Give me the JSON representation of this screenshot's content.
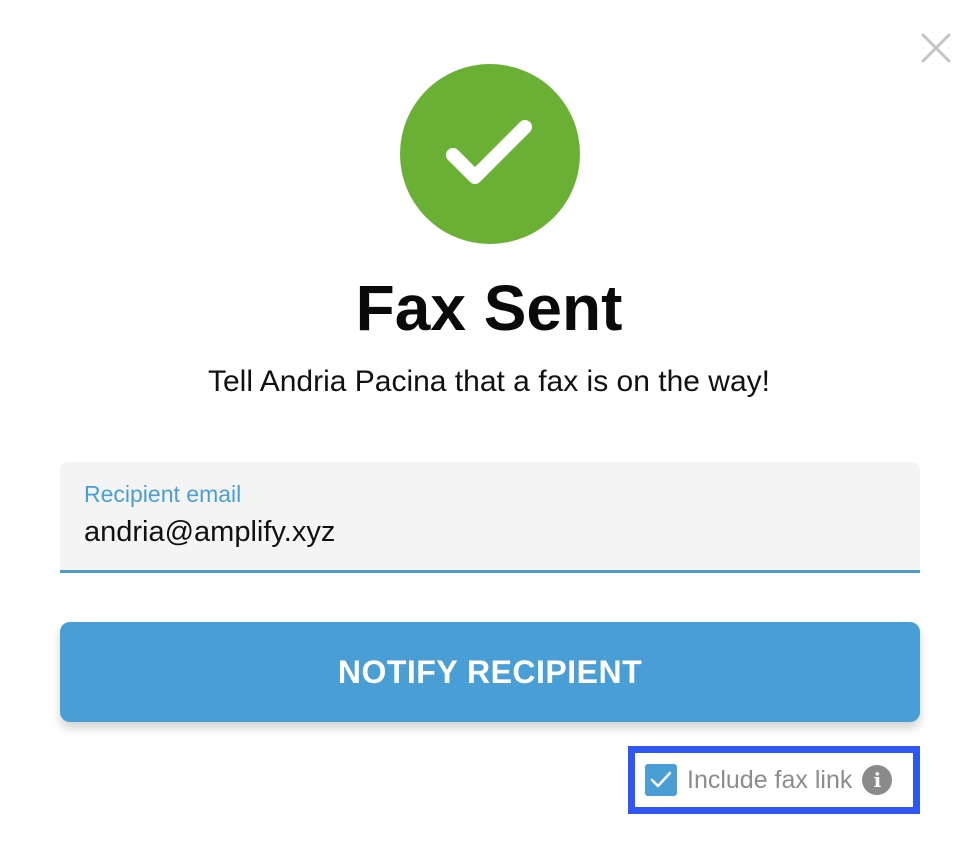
{
  "dialog": {
    "title": "Fax Sent",
    "subtitle": "Tell Andria Pacina that a fax is on the way!",
    "close_icon": "close-icon",
    "success_icon": "checkmark-icon"
  },
  "email": {
    "label": "Recipient email",
    "value": "andria@amplify.xyz"
  },
  "notify_button": {
    "label": "NOTIFY RECIPIENT"
  },
  "include_fax_link": {
    "label": "Include fax link",
    "checked": true,
    "info_icon": "info-icon",
    "info_glyph": "i"
  },
  "colors": {
    "success_green": "#6ab035",
    "accent_blue": "#4a9ed6",
    "highlight_border": "#2f55f5",
    "close_gray": "#c4c4c4"
  }
}
